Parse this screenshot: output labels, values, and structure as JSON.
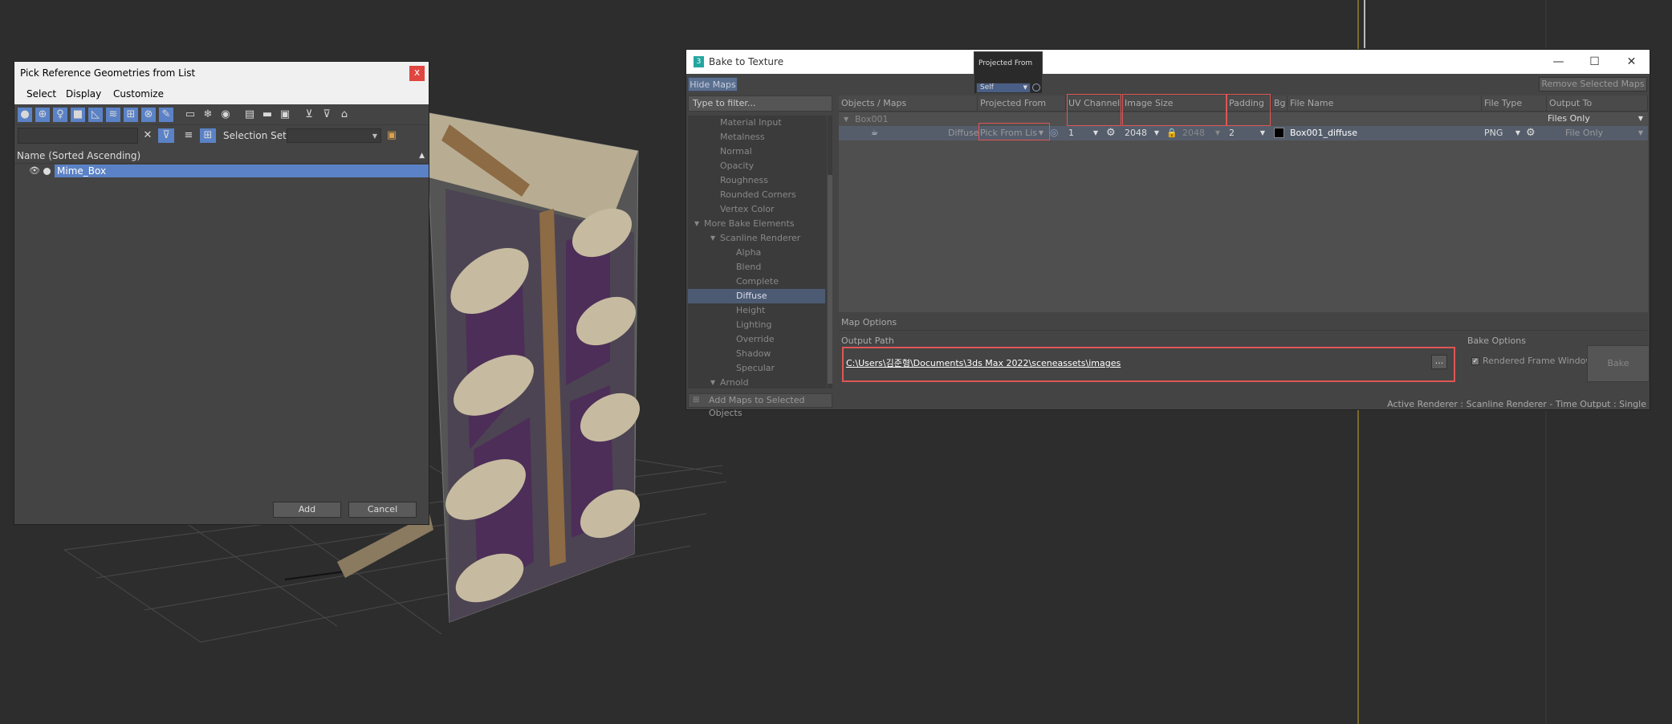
{
  "pick_dialog": {
    "title": "Pick Reference Geometries from List",
    "close_label": "x",
    "menu": [
      "Select",
      "Display",
      "Customize"
    ],
    "selection_set_label": "Selection Set:",
    "list_header": "Name (Sorted Ascending)",
    "items": [
      {
        "name": "Mime_Box"
      }
    ],
    "add_label": "Add",
    "cancel_label": "Cancel"
  },
  "bake_dialog": {
    "title": "Bake to Texture",
    "logo_label": "3",
    "hide_maps_label": "Hide Maps",
    "remove_selected_maps_label": "Remove Selected Maps",
    "filter_placeholder": "Type to filter...",
    "map_tree": [
      {
        "label": "Material Input",
        "level": 2
      },
      {
        "label": "Metalness",
        "level": 2
      },
      {
        "label": "Normal",
        "level": 2
      },
      {
        "label": "Opacity",
        "level": 2
      },
      {
        "label": "Roughness",
        "level": 2
      },
      {
        "label": "Rounded Corners",
        "level": 2
      },
      {
        "label": "Vertex Color",
        "level": 2
      },
      {
        "label": "More Bake Elements",
        "level": 1
      },
      {
        "label": "Scanline Renderer",
        "level": 2
      },
      {
        "label": "Alpha",
        "level": 3
      },
      {
        "label": "Blend",
        "level": 3
      },
      {
        "label": "Complete",
        "level": 3
      },
      {
        "label": "Diffuse",
        "level": 3
      },
      {
        "label": "Height",
        "level": 3
      },
      {
        "label": "Lighting",
        "level": 3
      },
      {
        "label": "Override",
        "level": 3
      },
      {
        "label": "Shadow",
        "level": 3
      },
      {
        "label": "Specular",
        "level": 3
      },
      {
        "label": "Arnold",
        "level": 2
      }
    ],
    "add_maps_label": "Add Maps to Selected Objects",
    "columns": [
      "Objects / Maps",
      "Projected From",
      "UV Channel",
      "Image Size",
      "Padding",
      "Bg",
      "File Name",
      "File Type",
      "Output To"
    ],
    "object_row": {
      "name": "Box001",
      "output_to": "Files Only"
    },
    "map_row": {
      "map_name": "Diffuse",
      "projected_from": "Pick From Lis",
      "uv_channel": "1",
      "image_width": "2048",
      "image_height": "2048",
      "padding": "2",
      "bg_color": "#000000",
      "file_name": "Box001_diffuse",
      "file_type": "PNG",
      "output_to": "File Only"
    },
    "map_options_label": "Map Options",
    "output_path_label": "Output Path",
    "output_path": "C:\\Users\\김준형\\Documents\\3ds Max 2022\\sceneassets\\images",
    "browse_label": "...",
    "bake_options_label": "Bake Options",
    "rendered_frame_window_label": "Rendered Frame Window",
    "rendered_frame_window_checked": true,
    "bake_label": "Bake",
    "status": "Active Renderer : Scanline Renderer  -  Time Output : Single"
  },
  "tooltip": {
    "title": "Projected From",
    "value": "Self"
  },
  "colors": {
    "accent": "#5b82c6",
    "highlight_box": "#e05555",
    "viewport_bg": "#2d2d2d"
  }
}
